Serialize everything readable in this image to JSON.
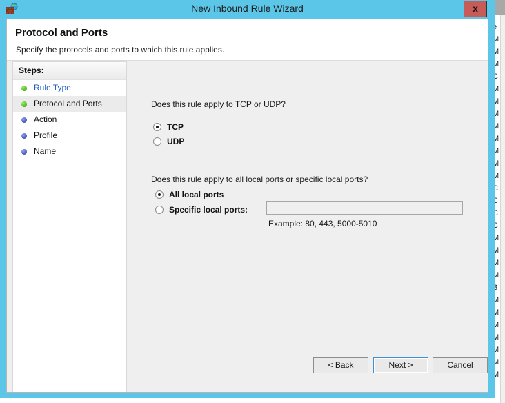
{
  "window": {
    "title": "New Inbound Rule Wizard",
    "icon": "firewall-globe-icon",
    "close_label": "x",
    "titlebar_color": "#5bc6e8"
  },
  "header": {
    "title": "Protocol and Ports",
    "subtitle": "Specify the protocols and ports to which this rule applies."
  },
  "sidebar": {
    "heading": "Steps:",
    "items": [
      {
        "label": "Rule Type",
        "state": "link",
        "bullet": "green"
      },
      {
        "label": "Protocol and Ports",
        "state": "current",
        "bullet": "green"
      },
      {
        "label": "Action",
        "state": "upcoming",
        "bullet": "blue"
      },
      {
        "label": "Profile",
        "state": "upcoming",
        "bullet": "blue"
      },
      {
        "label": "Name",
        "state": "upcoming",
        "bullet": "blue"
      }
    ]
  },
  "content": {
    "protocol_question": "Does this rule apply to TCP or UDP?",
    "protocol_options": [
      {
        "label": "TCP",
        "selected": true
      },
      {
        "label": "UDP",
        "selected": false
      }
    ],
    "ports_question": "Does this rule apply to all local ports or specific local ports?",
    "ports_options": [
      {
        "label": "All local ports",
        "selected": true
      },
      {
        "label": "Specific local ports:",
        "selected": false
      }
    ],
    "ports_input_value": "",
    "ports_input_placeholder": "",
    "ports_example": "Example: 80, 443, 5000-5010"
  },
  "footer": {
    "back_label": "< Back",
    "next_label": "Next >",
    "cancel_label": "Cancel"
  },
  "background_window": {
    "rows": [
      "e",
      "M",
      "M",
      "M",
      "C",
      "M",
      "M",
      "M",
      "M",
      "M",
      "M",
      "M",
      "M",
      "C",
      "C",
      "C",
      "C",
      "M",
      "M",
      "M",
      "M",
      "B",
      "M",
      "M",
      "M",
      "M",
      "M",
      "M",
      "M"
    ]
  }
}
